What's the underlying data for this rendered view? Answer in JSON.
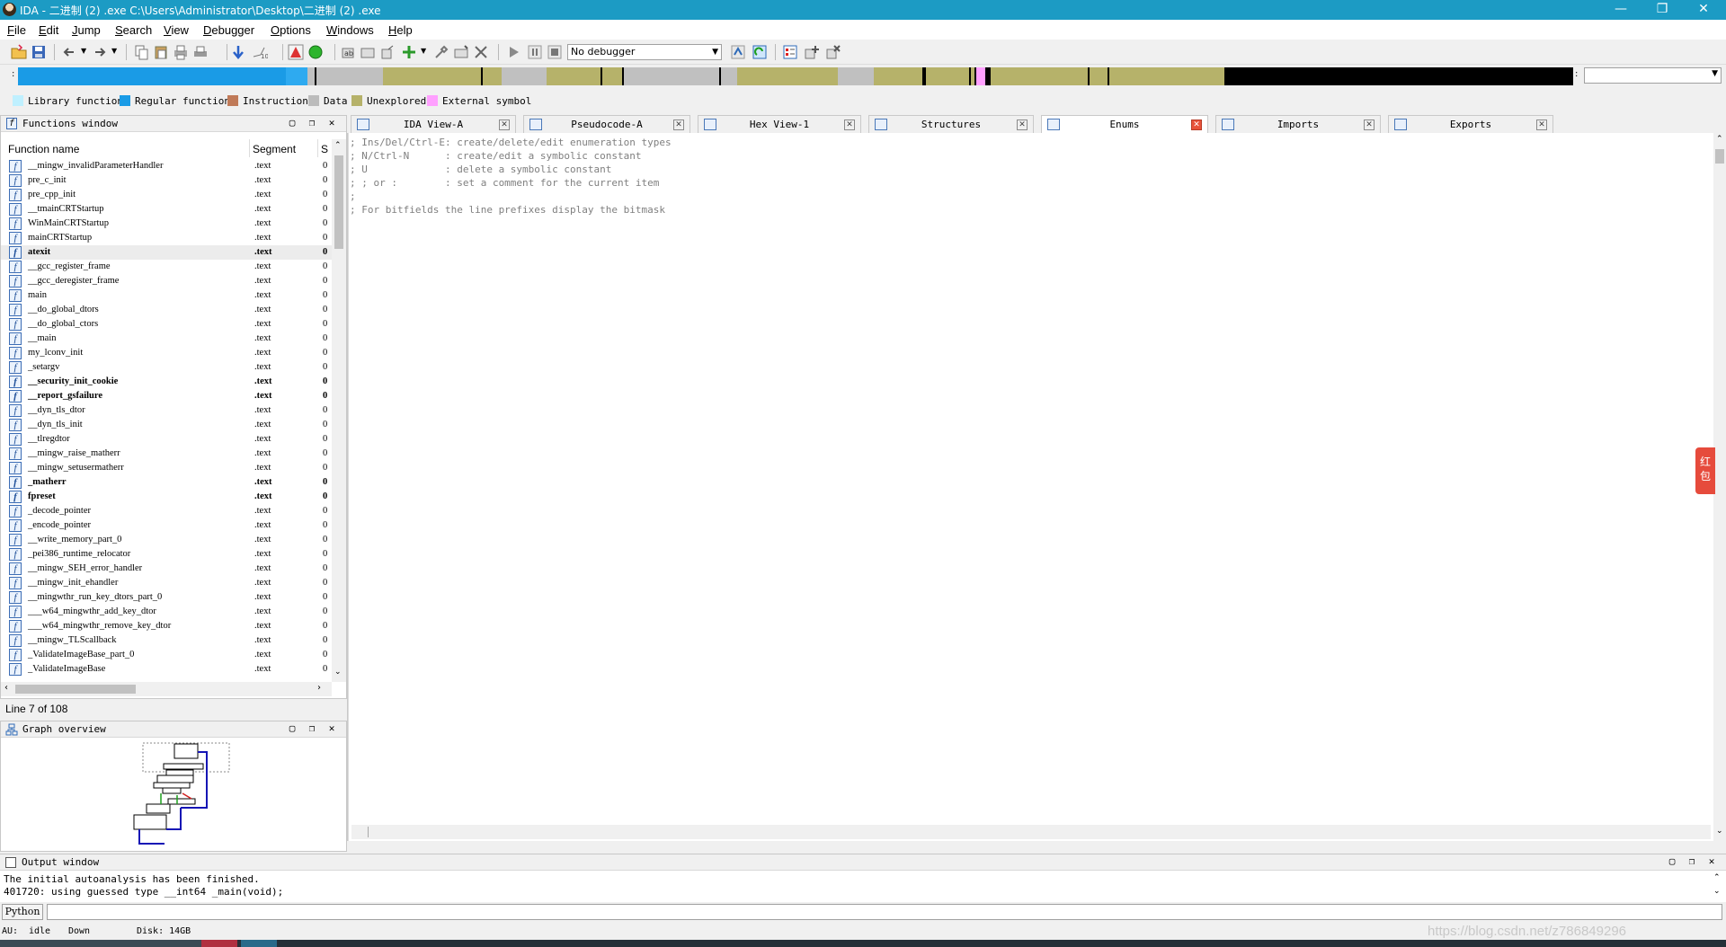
{
  "window": {
    "title": "IDA - 二进制 (2) .exe C:\\Users\\Administrator\\Desktop\\二进制 (2) .exe",
    "minimize": "—",
    "maximize": "❐",
    "close": "✕"
  },
  "menu": [
    "File",
    "Edit",
    "Jump",
    "Search",
    "View",
    "Debugger",
    "Options",
    "Windows",
    "Help"
  ],
  "toolbar": {
    "debugger_select": "No debugger"
  },
  "legend": [
    {
      "label": "Library function",
      "color": "#bff0ff"
    },
    {
      "label": "Regular function",
      "color": "#1a9be6"
    },
    {
      "label": "Instruction",
      "color": "#c07a58"
    },
    {
      "label": "Data",
      "color": "#bcbcbc"
    },
    {
      "label": "Unexplored",
      "color": "#b6b26a"
    },
    {
      "label": "External symbol",
      "color": "#ffa0ff"
    }
  ],
  "functions_window": {
    "title": "Functions window",
    "col_name": "Function name",
    "col_segment": "Segment",
    "col_extra": "S",
    "rows": [
      {
        "name": "__mingw_invalidParameterHandler",
        "segment": ".text",
        "x": "0",
        "bold": false
      },
      {
        "name": "pre_c_init",
        "segment": ".text",
        "x": "0",
        "bold": false
      },
      {
        "name": "pre_cpp_init",
        "segment": ".text",
        "x": "0",
        "bold": false
      },
      {
        "name": "__tmainCRTStartup",
        "segment": ".text",
        "x": "0",
        "bold": false
      },
      {
        "name": "WinMainCRTStartup",
        "segment": ".text",
        "x": "0",
        "bold": false
      },
      {
        "name": "mainCRTStartup",
        "segment": ".text",
        "x": "0",
        "bold": false
      },
      {
        "name": "atexit",
        "segment": ".text",
        "x": "0",
        "bold": true
      },
      {
        "name": "__gcc_register_frame",
        "segment": ".text",
        "x": "0",
        "bold": false
      },
      {
        "name": "__gcc_deregister_frame",
        "segment": ".text",
        "x": "0",
        "bold": false
      },
      {
        "name": "main",
        "segment": ".text",
        "x": "0",
        "bold": false
      },
      {
        "name": "__do_global_dtors",
        "segment": ".text",
        "x": "0",
        "bold": false
      },
      {
        "name": "__do_global_ctors",
        "segment": ".text",
        "x": "0",
        "bold": false
      },
      {
        "name": "__main",
        "segment": ".text",
        "x": "0",
        "bold": false
      },
      {
        "name": "my_lconv_init",
        "segment": ".text",
        "x": "0",
        "bold": false
      },
      {
        "name": "_setargv",
        "segment": ".text",
        "x": "0",
        "bold": false
      },
      {
        "name": "__security_init_cookie",
        "segment": ".text",
        "x": "0",
        "bold": true
      },
      {
        "name": "__report_gsfailure",
        "segment": ".text",
        "x": "0",
        "bold": true
      },
      {
        "name": "__dyn_tls_dtor",
        "segment": ".text",
        "x": "0",
        "bold": false
      },
      {
        "name": "__dyn_tls_init",
        "segment": ".text",
        "x": "0",
        "bold": false
      },
      {
        "name": "__tlregdtor",
        "segment": ".text",
        "x": "0",
        "bold": false
      },
      {
        "name": "__mingw_raise_matherr",
        "segment": ".text",
        "x": "0",
        "bold": false
      },
      {
        "name": "__mingw_setusermatherr",
        "segment": ".text",
        "x": "0",
        "bold": false
      },
      {
        "name": "_matherr",
        "segment": ".text",
        "x": "0",
        "bold": true
      },
      {
        "name": "fpreset",
        "segment": ".text",
        "x": "0",
        "bold": true
      },
      {
        "name": "_decode_pointer",
        "segment": ".text",
        "x": "0",
        "bold": false
      },
      {
        "name": "_encode_pointer",
        "segment": ".text",
        "x": "0",
        "bold": false
      },
      {
        "name": "__write_memory_part_0",
        "segment": ".text",
        "x": "0",
        "bold": false
      },
      {
        "name": "_pei386_runtime_relocator",
        "segment": ".text",
        "x": "0",
        "bold": false
      },
      {
        "name": "__mingw_SEH_error_handler",
        "segment": ".text",
        "x": "0",
        "bold": false
      },
      {
        "name": "__mingw_init_ehandler",
        "segment": ".text",
        "x": "0",
        "bold": false
      },
      {
        "name": "__mingwthr_run_key_dtors_part_0",
        "segment": ".text",
        "x": "0",
        "bold": false
      },
      {
        "name": "___w64_mingwthr_add_key_dtor",
        "segment": ".text",
        "x": "0",
        "bold": false
      },
      {
        "name": "___w64_mingwthr_remove_key_dtor",
        "segment": ".text",
        "x": "0",
        "bold": false
      },
      {
        "name": "__mingw_TLScallback",
        "segment": ".text",
        "x": "0",
        "bold": false
      },
      {
        "name": "_ValidateImageBase_part_0",
        "segment": ".text",
        "x": "0",
        "bold": false
      },
      {
        "name": "_ValidateImageBase",
        "segment": ".text",
        "x": "0",
        "bold": false
      }
    ]
  },
  "line_status": "Line 7 of 108",
  "graph_overview": {
    "title": "Graph overview"
  },
  "tabs": [
    {
      "label": "IDA View-A",
      "active": false
    },
    {
      "label": "Pseudocode-A",
      "active": false
    },
    {
      "label": "Hex View-1",
      "active": false
    },
    {
      "label": "Structures",
      "active": false
    },
    {
      "label": "Enums",
      "active": true
    },
    {
      "label": "Imports",
      "active": false
    },
    {
      "label": "Exports",
      "active": false
    }
  ],
  "enums_view": {
    "lines": [
      "; Ins/Del/Ctrl-E: create/delete/edit enumeration types",
      "; N/Ctrl-N      : create/edit a symbolic constant",
      "; U             : delete a symbolic constant",
      "; ; or :        : set a comment for the current item",
      ";",
      "; For bitfields the line prefixes display the bitmask"
    ]
  },
  "output_window": {
    "title": "Output window",
    "lines": [
      "The initial autoanalysis has been finished.",
      "401720: using guessed type __int64 _main(void);"
    ]
  },
  "python_button": "Python",
  "status": {
    "au_label": "AU:",
    "au_value": "idle",
    "direction": "Down",
    "disk": "Disk: 14GB"
  },
  "watermark": "https://blog.csdn.net/z786849296",
  "side_widget": "红包"
}
